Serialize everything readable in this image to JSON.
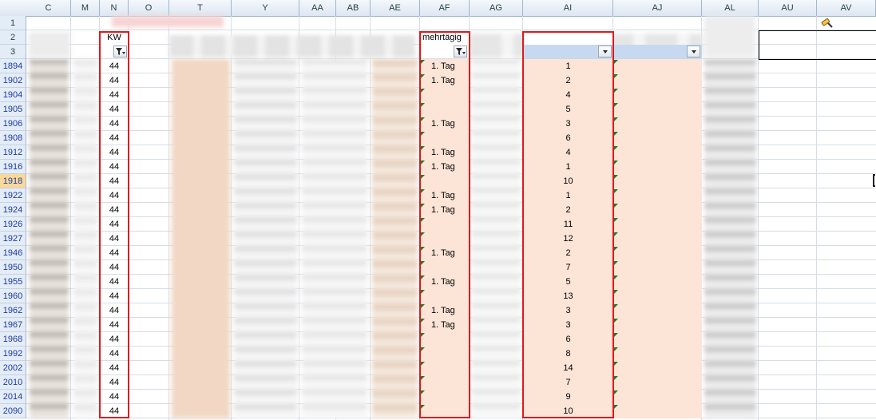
{
  "columns": [
    "C",
    "M",
    "N",
    "O",
    "T",
    "Y",
    "AA",
    "AB",
    "AE",
    "AF",
    "AG",
    "AI",
    "AJ",
    "AL",
    "AU",
    "AV"
  ],
  "header_rows": [
    "1",
    "2",
    "3"
  ],
  "row2": {
    "kw_label": "KW",
    "mehrtaegig_label": "mehrtägig"
  },
  "rows": [
    {
      "row": "1894",
      "kw": "44",
      "af": "1. Tag",
      "ai": "1"
    },
    {
      "row": "1902",
      "kw": "44",
      "af": "1. Tag",
      "ai": "2"
    },
    {
      "row": "1904",
      "kw": "44",
      "af": "",
      "ai": "4"
    },
    {
      "row": "1905",
      "kw": "44",
      "af": "",
      "ai": "5"
    },
    {
      "row": "1906",
      "kw": "44",
      "af": "1. Tag",
      "ai": "3"
    },
    {
      "row": "1908",
      "kw": "44",
      "af": "",
      "ai": "6"
    },
    {
      "row": "1912",
      "kw": "44",
      "af": "1. Tag",
      "ai": "4"
    },
    {
      "row": "1916",
      "kw": "44",
      "af": "1. Tag",
      "ai": "1"
    },
    {
      "row": "1918",
      "kw": "44",
      "af": "",
      "ai": "10"
    },
    {
      "row": "1922",
      "kw": "44",
      "af": "1. Tag",
      "ai": "1"
    },
    {
      "row": "1924",
      "kw": "44",
      "af": "1. Tag",
      "ai": "2"
    },
    {
      "row": "1926",
      "kw": "44",
      "af": "",
      "ai": "11"
    },
    {
      "row": "1927",
      "kw": "44",
      "af": "",
      "ai": "12"
    },
    {
      "row": "1946",
      "kw": "44",
      "af": "1. Tag",
      "ai": "2"
    },
    {
      "row": "1950",
      "kw": "44",
      "af": "",
      "ai": "7"
    },
    {
      "row": "1955",
      "kw": "44",
      "af": "1. Tag",
      "ai": "5"
    },
    {
      "row": "1960",
      "kw": "44",
      "af": "",
      "ai": "13"
    },
    {
      "row": "1962",
      "kw": "44",
      "af": "1. Tag",
      "ai": "3"
    },
    {
      "row": "1967",
      "kw": "44",
      "af": "1. Tag",
      "ai": "3"
    },
    {
      "row": "1968",
      "kw": "44",
      "af": "",
      "ai": "6"
    },
    {
      "row": "1992",
      "kw": "44",
      "af": "",
      "ai": "8"
    },
    {
      "row": "2002",
      "kw": "44",
      "af": "",
      "ai": "14"
    },
    {
      "row": "2010",
      "kw": "44",
      "af": "",
      "ai": "7"
    },
    {
      "row": "2014",
      "kw": "44",
      "af": "",
      "ai": "9"
    },
    {
      "row": "2090",
      "kw": "44",
      "af": "",
      "ai": "10"
    }
  ],
  "selected_row": "1918",
  "colors": {
    "highlight_border": "#e0191b",
    "peach_fill": "#fce4d6",
    "header_blue": "#dde6f2"
  },
  "icons": {
    "filter": "filter-funnel-icon",
    "dropdown": "dropdown-arrow-icon",
    "brush": "format-painter-icon"
  }
}
